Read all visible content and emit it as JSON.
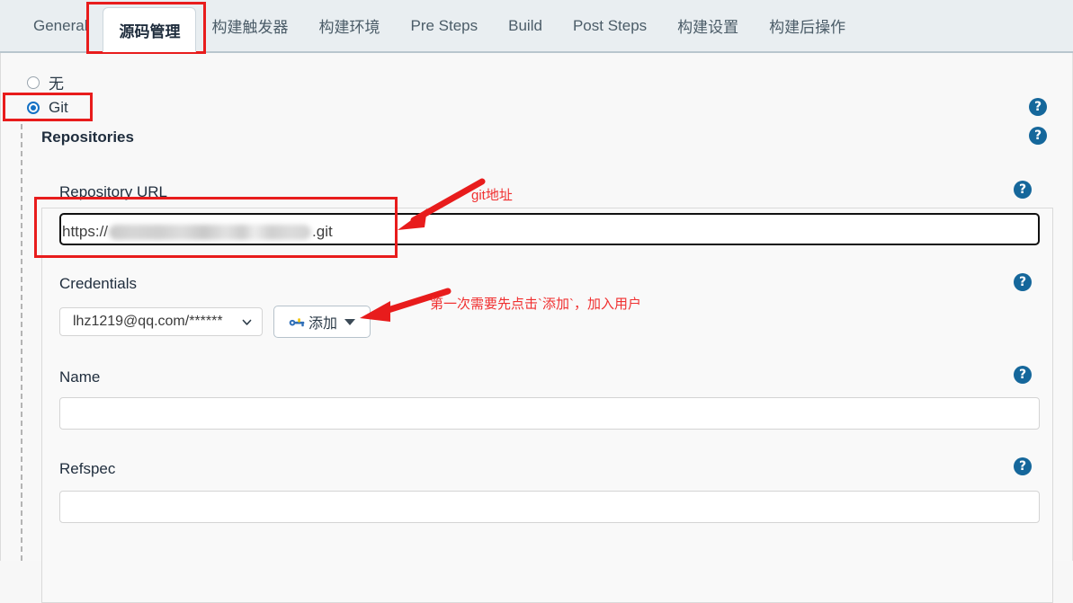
{
  "tabs": [
    {
      "label": "General",
      "active": false
    },
    {
      "label": "源码管理",
      "active": true
    },
    {
      "label": "构建触发器",
      "active": false
    },
    {
      "label": "构建环境",
      "active": false
    },
    {
      "label": "Pre Steps",
      "active": false
    },
    {
      "label": "Build",
      "active": false
    },
    {
      "label": "Post Steps",
      "active": false
    },
    {
      "label": "构建设置",
      "active": false
    },
    {
      "label": "构建后操作",
      "active": false
    }
  ],
  "scm": {
    "options": [
      {
        "label": "无",
        "selected": false
      },
      {
        "label": "Git",
        "selected": true
      }
    ]
  },
  "git": {
    "section_title": "Repositories",
    "repository_url": {
      "label": "Repository URL",
      "prefix": "https://",
      "suffix": ".git",
      "redacted": true,
      "placeholder": ""
    },
    "credentials": {
      "label": "Credentials",
      "selected": "lhz1219@qq.com/******",
      "add_button": "添加",
      "add_icon": "key-icon"
    },
    "name": {
      "label": "Name",
      "value": "",
      "placeholder": ""
    },
    "refspec": {
      "label": "Refspec",
      "value": "",
      "placeholder": ""
    }
  },
  "help": {
    "glyph": "?",
    "icon_name": "help-icon",
    "count": 6
  },
  "annotations": [
    {
      "text": "git地址",
      "target": "repository-url-field"
    },
    {
      "text": "第一次需要先点击`添加`，加入用户",
      "target": "credentials-add-button"
    }
  ],
  "colors": {
    "accent": "#15679b",
    "radio_checked": "#1471c4",
    "annotation_red": "#e81c1c",
    "annotation_text_red": "#f03030",
    "tabbar_bg": "#e9eef1",
    "page_bg": "#f8f8f8"
  }
}
